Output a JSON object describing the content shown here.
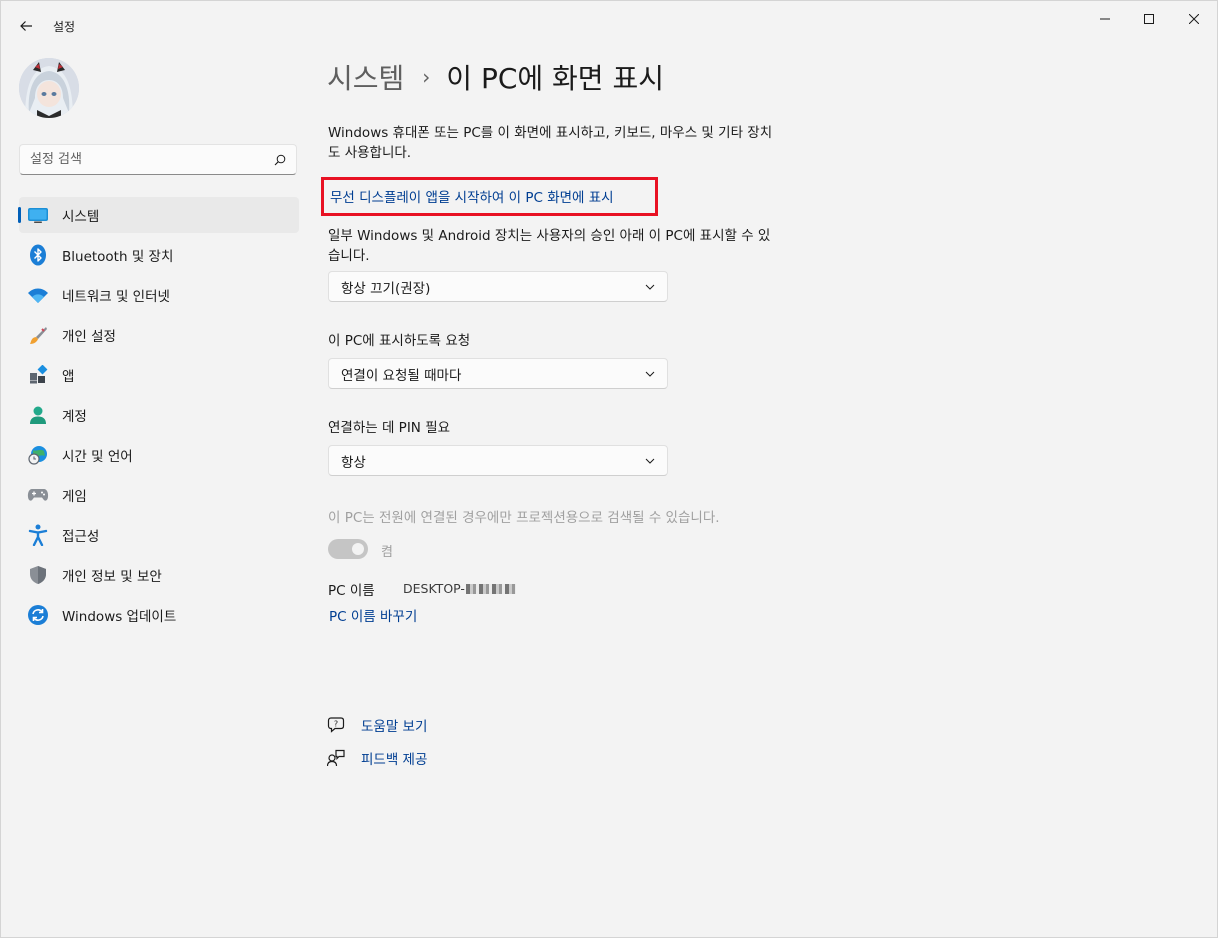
{
  "window": {
    "title": "설정"
  },
  "sidebar": {
    "search_placeholder": "설정 검색",
    "items": [
      {
        "label": "시스템",
        "icon": "monitor-icon"
      },
      {
        "label": "Bluetooth 및 장치",
        "icon": "bluetooth-icon"
      },
      {
        "label": "네트워크 및 인터넷",
        "icon": "wifi-icon"
      },
      {
        "label": "개인 설정",
        "icon": "paintbrush-icon"
      },
      {
        "label": "앱",
        "icon": "apps-icon"
      },
      {
        "label": "계정",
        "icon": "person-icon"
      },
      {
        "label": "시간 및 언어",
        "icon": "globe-clock-icon"
      },
      {
        "label": "게임",
        "icon": "gamepad-icon"
      },
      {
        "label": "접근성",
        "icon": "accessibility-icon"
      },
      {
        "label": "개인 정보 및 보안",
        "icon": "shield-icon"
      },
      {
        "label": "Windows 업데이트",
        "icon": "update-icon"
      }
    ]
  },
  "header": {
    "breadcrumb_parent": "시스템",
    "breadcrumb_separator": "›",
    "breadcrumb_current": "이 PC에 화면 표시"
  },
  "main": {
    "description": "Windows 휴대폰 또는 PC를 이 화면에 표시하고, 키보드, 마우스 및 기타 장치도 사용합니다.",
    "launch_link": "무선 디스플레이 앱을 시작하여 이 PC 화면에 표시",
    "availability_label": "일부 Windows 및 Android 장치는 사용자의 승인 아래 이 PC에 표시할 수 있습니다.",
    "availability_value": "항상 끄기(권장)",
    "request_label": "이 PC에 표시하도록 요청",
    "request_value": "연결이 요청될 때마다",
    "pin_label": "연결하는 데 PIN 필요",
    "pin_value": "항상",
    "power_text": "이 PC는 전원에 연결된 경우에만 프로젝션용으로 검색될 수 있습니다.",
    "power_toggle_label": "켬",
    "pc_name_label": "PC 이름",
    "pc_name_value": "DESKTOP-",
    "rename_link": "PC 이름 바꾸기",
    "help_link": "도움말 보기",
    "feedback_link": "피드백 제공"
  },
  "colors": {
    "accent": "#005fb8",
    "link": "#003e92",
    "highlight": "#e81123"
  }
}
